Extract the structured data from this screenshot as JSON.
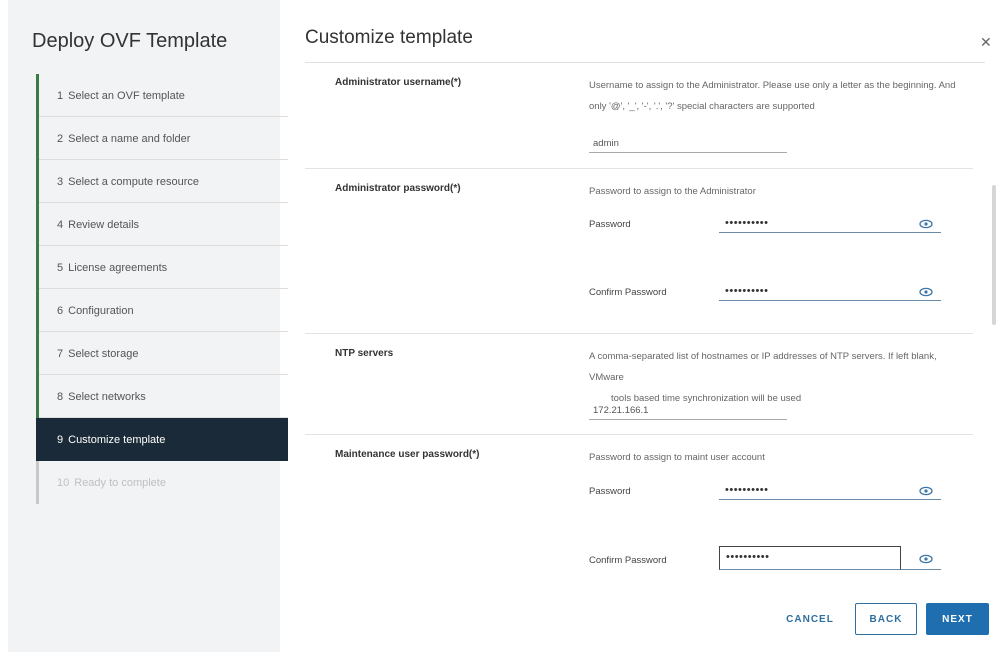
{
  "wizard": {
    "title": "Deploy OVF Template",
    "steps": [
      {
        "num": "1",
        "label": "Select an OVF template",
        "state": "done"
      },
      {
        "num": "2",
        "label": "Select a name and folder",
        "state": "done"
      },
      {
        "num": "3",
        "label": "Select a compute resource",
        "state": "done"
      },
      {
        "num": "4",
        "label": "Review details",
        "state": "done"
      },
      {
        "num": "5",
        "label": "License agreements",
        "state": "done"
      },
      {
        "num": "6",
        "label": "Configuration",
        "state": "done"
      },
      {
        "num": "7",
        "label": "Select storage",
        "state": "done"
      },
      {
        "num": "8",
        "label": "Select networks",
        "state": "done"
      },
      {
        "num": "9",
        "label": "Customize template",
        "state": "active"
      },
      {
        "num": "10",
        "label": "Ready to complete",
        "state": "disabled"
      }
    ]
  },
  "page": {
    "title": "Customize template",
    "close_icon": "close-icon"
  },
  "form": {
    "admin_username": {
      "label": "Administrator username(*)",
      "desc": "Username to assign to the Administrator. Please use only a letter as the beginning. And only '@', '_', '-', '.', '?' special characters are supported",
      "value": "admin"
    },
    "admin_password": {
      "label": "Administrator password(*)",
      "desc": "Password to assign to the Administrator",
      "password_label": "Password",
      "password_value": "••••••••••",
      "confirm_label": "Confirm Password",
      "confirm_value": "••••••••••"
    },
    "ntp": {
      "label": "NTP servers",
      "desc_line1": "A comma-separated list of hostnames or IP addresses of NTP servers. If left blank, VMware",
      "desc_line2": "tools based time synchronization will be used",
      "value": "172.21.166.1"
    },
    "maint_password": {
      "label": "Maintenance user password(*)",
      "desc": "Password to assign to maint user account",
      "password_label": "Password",
      "password_value": "••••••••••",
      "confirm_label": "Confirm Password",
      "confirm_value": "••••••••••"
    }
  },
  "footer": {
    "cancel": "CANCEL",
    "back": "BACK",
    "next": "NEXT"
  },
  "colors": {
    "active_step_bg": "#1b2a38",
    "done_bar": "#3a7d44",
    "primary": "#1f6fb0"
  }
}
